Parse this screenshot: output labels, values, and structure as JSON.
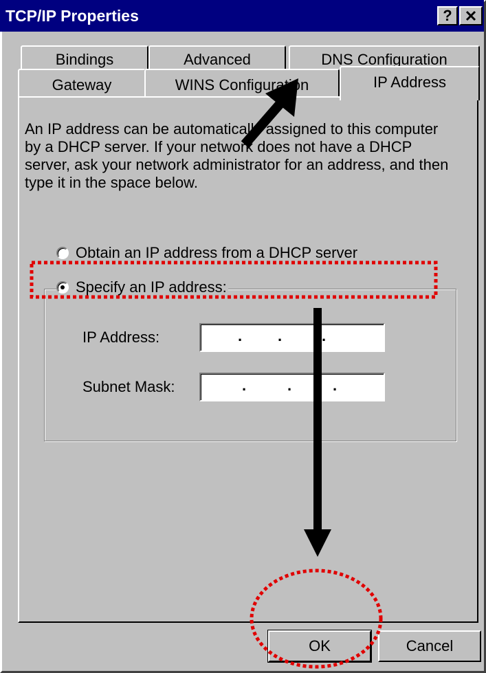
{
  "window": {
    "title": "TCP/IP Properties",
    "help_button": "?",
    "close_button": "×"
  },
  "tabs": {
    "back_row": [
      "Bindings",
      "Advanced",
      "DNS Configuration"
    ],
    "front_row": [
      "Gateway",
      "WINS Configuration",
      "IP Address"
    ],
    "active": "IP Address"
  },
  "description": {
    "lines": [
      "An IP address can be automatically assigned to this computer",
      "by a DHCP server. If your network does not have a DHCP",
      "server, ask your network administrator for an address, and then",
      "type it in the space below."
    ]
  },
  "options": {
    "obtain_label": "Obtain an IP address from a DHCP server",
    "obtain_checked": false,
    "specify_label": "Specify an IP address:",
    "specify_checked": true
  },
  "fields": {
    "ip_label": "IP Address:",
    "subnet_label": "Subnet Mask:"
  },
  "buttons": {
    "ok": "OK",
    "cancel": "Cancel"
  },
  "colors": {
    "face": "#c0c0c0",
    "titlebar": "#000080",
    "annotation_red": "#e00000"
  }
}
